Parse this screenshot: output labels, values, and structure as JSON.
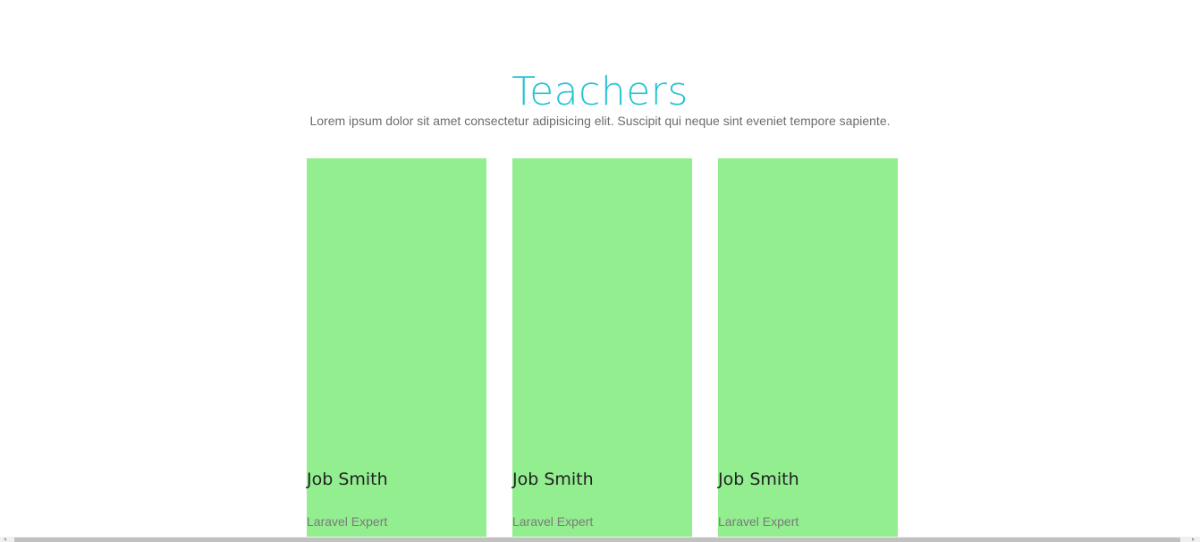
{
  "section": {
    "title": "Teachers",
    "subtitle": "Lorem ipsum dolor sit amet consectetur adipisicing elit. Suscipit qui neque sint eveniet tempore sapiente."
  },
  "teachers": [
    {
      "name": "Job Smith",
      "role": "Laravel Expert"
    },
    {
      "name": "Job Smith",
      "role": "Laravel Expert"
    },
    {
      "name": "Job Smith",
      "role": "Laravel Expert"
    }
  ],
  "colors": {
    "title": "#28c3d4",
    "subtitle": "#6c6c6c",
    "card_background": "#93ee90",
    "role": "#7a7a7a"
  },
  "icons": {
    "scroll_left": "chevron-left-icon",
    "scroll_right": "chevron-right-icon"
  }
}
